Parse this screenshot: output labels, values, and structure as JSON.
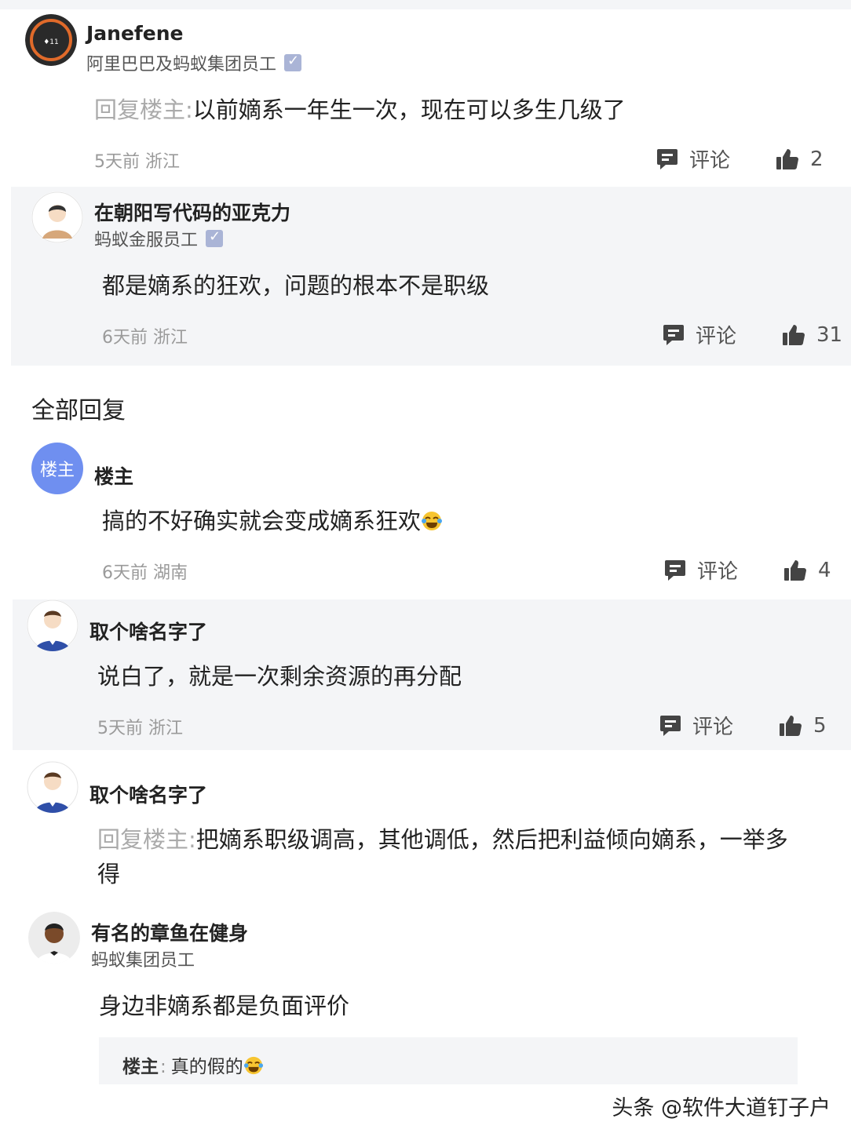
{
  "comments": [
    {
      "username": "Janefene",
      "title": "阿里巴巴及蚂蚁集团员工",
      "reply_prefix": "回复楼主:",
      "text": "以前嫡系一年生一次，现在可以多生几级了",
      "time_place": "5天前 浙江",
      "comment_label": "评论",
      "likes": "2"
    },
    {
      "username": "在朝阳写代码的亚克力",
      "title": "蚂蚁金服员工",
      "text": "都是嫡系的狂欢，问题的根本不是职级",
      "time_place": "6天前 浙江",
      "comment_label": "评论",
      "likes": "31"
    }
  ],
  "section_title": "全部回复",
  "replies": [
    {
      "avatar_text": "楼主",
      "username": "楼主",
      "text": "搞的不好确实就会变成嫡系狂欢",
      "emoji": "laugh-cry-emoji",
      "time_place": "6天前 湖南",
      "comment_label": "评论",
      "likes": "4"
    },
    {
      "username": "取个啥名字了",
      "text": "说白了，就是一次剩余资源的再分配",
      "time_place": "5天前 浙江",
      "comment_label": "评论",
      "likes": "5"
    },
    {
      "username": "取个啥名字了",
      "reply_prefix": "回复楼主:",
      "text_line1": "把嫡系职级调高，其他调低，然后把利益倾向嫡系，一举多",
      "text_line2": "得"
    },
    {
      "username": "有名的章鱼在健身",
      "title": "蚂蚁集团员工",
      "text": "身边非嫡系都是负面评价",
      "quote_author": "楼主",
      "quote_sep": ":",
      "quote_text": "真的假的"
    }
  ],
  "watermark": "头条 @软件大道钉子户",
  "colors": {
    "shaded_bg": "#f4f5f7",
    "muted_text": "#9a9a9a",
    "reply_prefix": "#aaaaaa",
    "owner_avatar": "#6f8ff0",
    "verified_badge": "#aab4d6",
    "icon": "#444444"
  }
}
